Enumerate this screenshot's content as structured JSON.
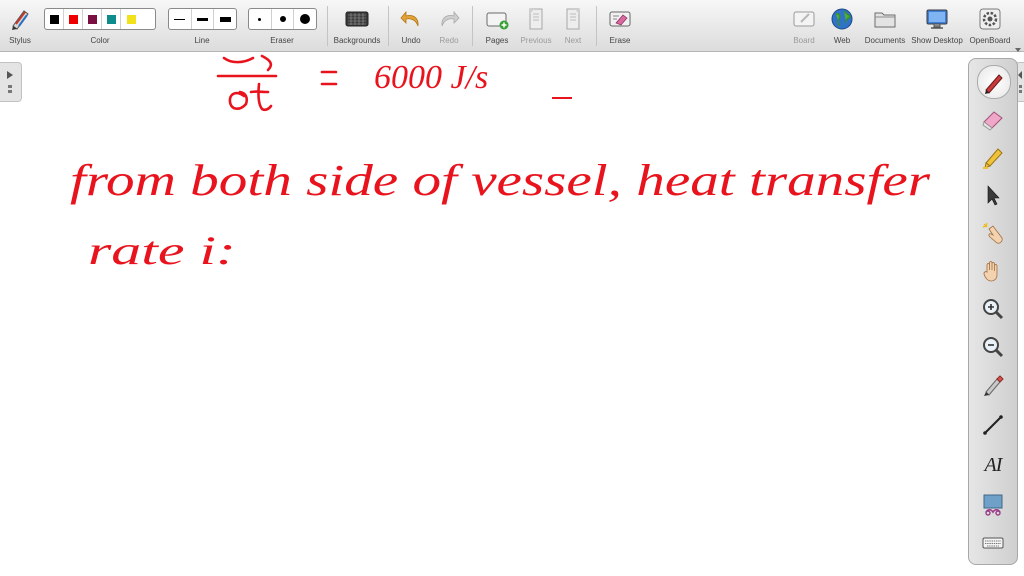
{
  "toolbar": {
    "stylus_label": "Stylus",
    "color_label": "Color",
    "line_label": "Line",
    "eraser_label": "Eraser",
    "backgrounds_label": "Backgrounds",
    "undo_label": "Undo",
    "redo_label": "Redo",
    "pages_label": "Pages",
    "previous_label": "Previous",
    "next_label": "Next",
    "erase_label": "Erase",
    "board_label": "Board",
    "web_label": "Web",
    "documents_label": "Documents",
    "show_desktop_label": "Show Desktop",
    "openboard_label": "OpenBoard",
    "colors": [
      "#000000",
      "#ee0000",
      "#7a1042",
      "#0e8c8c",
      "#f2e21c"
    ]
  },
  "palette": {
    "text_tool_glyph": "AI",
    "tools": [
      "pen-icon",
      "eraser-icon",
      "marker-icon",
      "pointer-icon",
      "laser-icon",
      "hand-icon",
      "zoom-in-icon",
      "zoom-out-icon",
      "capture-icon",
      "line-icon",
      "text-icon",
      "screenshot-icon",
      "keyboard-icon"
    ]
  },
  "board": {
    "ink_color": "#e8131d",
    "line1_text": "6000 J/s",
    "line2_text": "from both side of vessel, heat transfer",
    "line3_text": "rate i:"
  }
}
